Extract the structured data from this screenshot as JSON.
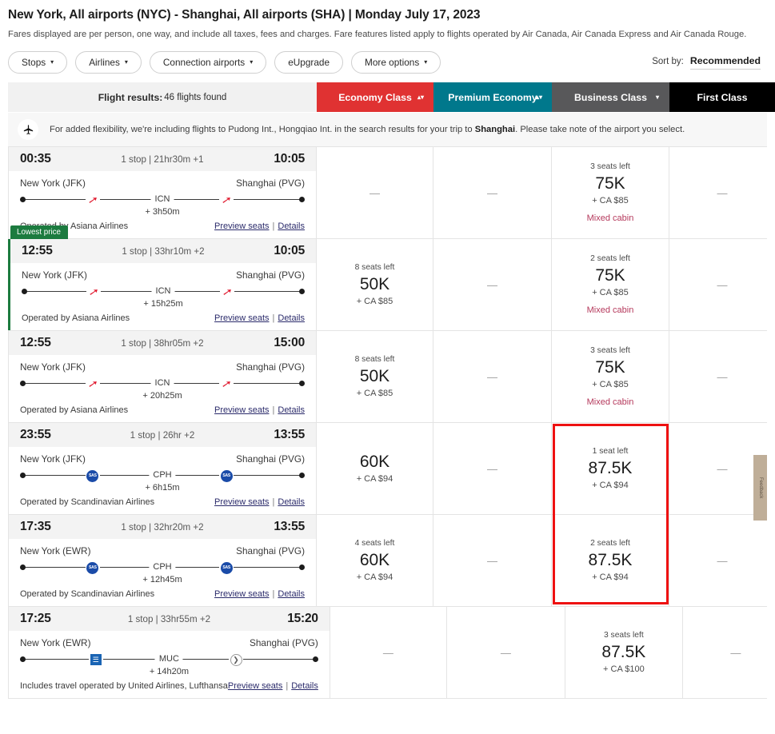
{
  "header": {
    "route_title": "New York, All airports (NYC) - Shanghai, All airports (SHA)  |  Monday July 17, 2023",
    "fare_note": "Fares displayed are per person, one way, and include all taxes, fees and charges. Fare features listed apply to flights operated by Air Canada, Air Canada Express and Air Canada Rouge."
  },
  "filters": [
    {
      "label": "Stops",
      "caret": "▾"
    },
    {
      "label": "Airlines",
      "caret": "▾"
    },
    {
      "label": "Connection airports",
      "caret": "▾"
    },
    {
      "label": "eUpgrade",
      "caret": ""
    },
    {
      "label": "More options",
      "caret": "▾"
    }
  ],
  "sort": {
    "label": "Sort by:",
    "value": "Recommended"
  },
  "results_summary": {
    "label": "Flight results:",
    "count": "46 flights found"
  },
  "class_tabs": [
    {
      "label": "Economy Class",
      "color": "#e03232",
      "stepper": "▴▾"
    },
    {
      "label": "Premium Economy",
      "color": "#00788c",
      "stepper": "▴▾"
    },
    {
      "label": "Business Class",
      "color": "#58585a",
      "stepper": "▾"
    },
    {
      "label": "First Class",
      "color": "#000000",
      "stepper": ""
    }
  ],
  "info_banner": {
    "icon": "airplane-icon",
    "text_before": "For added flexibility, we're including flights to Pudong Int., Hongqiao Int. in the search results for your trip to ",
    "text_bold": "Shanghai",
    "text_after": ". Please take note of the airport you select."
  },
  "links": {
    "preview": "Preview seats",
    "separator": "|",
    "details": "Details"
  },
  "dash": "—",
  "edge_tab": {
    "text": "Feedback"
  },
  "flights": [
    {
      "dep_time": "00:35",
      "stops_dur": "1 stop | 21hr30m +1",
      "arr_time": "10:05",
      "origin": "New York (JFK)",
      "destination": "Shanghai (PVG)",
      "stop_code": "ICN",
      "layover": "+ 3h50m",
      "operated": "Operated by Asiana Airlines",
      "logo": "asiana-logo-icon",
      "logo2": "asiana-logo-icon",
      "lowest": false,
      "economy": {
        "seats": "",
        "miles": "",
        "taxes": "",
        "mixed": ""
      },
      "premium": {
        "seats": "",
        "miles": "",
        "taxes": "",
        "mixed": ""
      },
      "business": {
        "seats": "3 seats left",
        "miles": "75K",
        "taxes": "+ CA $85",
        "mixed": "Mixed cabin"
      },
      "first": {
        "seats": "",
        "miles": "",
        "taxes": "",
        "mixed": ""
      }
    },
    {
      "dep_time": "12:55",
      "stops_dur": "1 stop | 33hr10m +2",
      "arr_time": "10:05",
      "origin": "New York (JFK)",
      "destination": "Shanghai (PVG)",
      "stop_code": "ICN",
      "layover": "+ 15h25m",
      "operated": "Operated by Asiana Airlines",
      "logo": "asiana-logo-icon",
      "logo2": "asiana-logo-icon",
      "lowest": true,
      "lowest_badge": "Lowest price",
      "economy": {
        "seats": "8 seats left",
        "miles": "50K",
        "taxes": "+ CA $85",
        "mixed": ""
      },
      "premium": {
        "seats": "",
        "miles": "",
        "taxes": "",
        "mixed": ""
      },
      "business": {
        "seats": "2 seats left",
        "miles": "75K",
        "taxes": "+ CA $85",
        "mixed": "Mixed cabin"
      },
      "first": {
        "seats": "",
        "miles": "",
        "taxes": "",
        "mixed": ""
      }
    },
    {
      "dep_time": "12:55",
      "stops_dur": "1 stop | 38hr05m +2",
      "arr_time": "15:00",
      "origin": "New York (JFK)",
      "destination": "Shanghai (PVG)",
      "stop_code": "ICN",
      "layover": "+ 20h25m",
      "operated": "Operated by Asiana Airlines",
      "logo": "asiana-logo-icon",
      "logo2": "asiana-logo-icon",
      "lowest": false,
      "economy": {
        "seats": "8 seats left",
        "miles": "50K",
        "taxes": "+ CA $85",
        "mixed": ""
      },
      "premium": {
        "seats": "",
        "miles": "",
        "taxes": "",
        "mixed": ""
      },
      "business": {
        "seats": "3 seats left",
        "miles": "75K",
        "taxes": "+ CA $85",
        "mixed": "Mixed cabin"
      },
      "first": {
        "seats": "",
        "miles": "",
        "taxes": "",
        "mixed": ""
      }
    },
    {
      "dep_time": "23:55",
      "stops_dur": "1 stop | 26hr +2",
      "arr_time": "13:55",
      "origin": "New York (JFK)",
      "destination": "Shanghai (PVG)",
      "stop_code": "CPH",
      "layover": "+ 6h15m",
      "operated": "Operated by Scandinavian Airlines",
      "logo": "sas-logo-icon",
      "logo2": "sas-logo-icon",
      "lowest": false,
      "economy": {
        "seats": "",
        "miles": "60K",
        "taxes": "+ CA $94",
        "mixed": ""
      },
      "premium": {
        "seats": "",
        "miles": "",
        "taxes": "",
        "mixed": ""
      },
      "business": {
        "seats": "1 seat left",
        "miles": "87.5K",
        "taxes": "+ CA $94",
        "mixed": ""
      },
      "first": {
        "seats": "",
        "miles": "",
        "taxes": "",
        "mixed": ""
      }
    },
    {
      "dep_time": "17:35",
      "stops_dur": "1 stop | 32hr20m +2",
      "arr_time": "13:55",
      "origin": "New York (EWR)",
      "destination": "Shanghai (PVG)",
      "stop_code": "CPH",
      "layover": "+ 12h45m",
      "operated": "Operated by Scandinavian Airlines",
      "logo": "sas-logo-icon",
      "logo2": "sas-logo-icon",
      "lowest": false,
      "economy": {
        "seats": "4 seats left",
        "miles": "60K",
        "taxes": "+ CA $94",
        "mixed": ""
      },
      "premium": {
        "seats": "",
        "miles": "",
        "taxes": "",
        "mixed": ""
      },
      "business": {
        "seats": "2 seats left",
        "miles": "87.5K",
        "taxes": "+ CA $94",
        "mixed": ""
      },
      "first": {
        "seats": "",
        "miles": "",
        "taxes": "",
        "mixed": ""
      }
    },
    {
      "dep_time": "17:25",
      "stops_dur": "1 stop | 33hr55m +2",
      "arr_time": "15:20",
      "origin": "New York (EWR)",
      "destination": "Shanghai (PVG)",
      "stop_code": "MUC",
      "layover": "+ 14h20m",
      "operated": "Includes travel operated by United Airlines, Lufthansa",
      "logo": "united-logo-icon",
      "logo2": "lufthansa-logo-icon",
      "lowest": false,
      "economy": {
        "seats": "",
        "miles": "",
        "taxes": "",
        "mixed": ""
      },
      "premium": {
        "seats": "",
        "miles": "",
        "taxes": "",
        "mixed": ""
      },
      "business": {
        "seats": "3 seats left",
        "miles": "87.5K",
        "taxes": "+ CA $100",
        "mixed": ""
      },
      "first": {
        "seats": "",
        "miles": "",
        "taxes": "",
        "mixed": ""
      }
    }
  ],
  "annotation": {
    "color": "#ee1111",
    "target": "business-class-column-rows-4-5"
  }
}
